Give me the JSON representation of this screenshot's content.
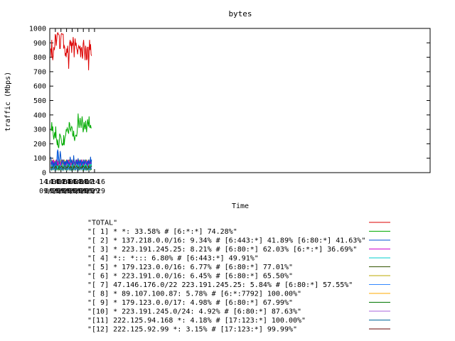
{
  "chart_data": {
    "type": "line",
    "title": "bytes",
    "xlabel": "Time",
    "ylabel": "traffic (Mbps)",
    "ylim": [
      0,
      1000
    ],
    "yticks": [
      0,
      100,
      200,
      300,
      400,
      500,
      600,
      700,
      800,
      900,
      1000
    ],
    "xlim_minutes": [
      840,
      976
    ],
    "xticks": [
      {
        "minute": 840,
        "time": "14:00",
        "date": "09/29"
      },
      {
        "minute": 842,
        "time": "14:02",
        "date": "09/29"
      },
      {
        "minute": 844,
        "time": "14:04",
        "date": "09/29"
      },
      {
        "minute": 846,
        "time": "14:06",
        "date": "09/29"
      },
      {
        "minute": 848,
        "time": "14:08",
        "date": "09/29"
      },
      {
        "minute": 850,
        "time": "14:10",
        "date": "09/29"
      },
      {
        "minute": 852,
        "time": "14:12",
        "date": "09/29"
      },
      {
        "minute": 854,
        "time": "14:14",
        "date": "09/29"
      },
      {
        "minute": 856,
        "time": "14:16",
        "date": "09/29"
      }
    ],
    "grid": false,
    "legend_position": "bottom",
    "series": [
      {
        "name": "\"TOTAL\"",
        "color": "#dd0000",
        "values": [
          860,
          800,
          920,
          820,
          780,
          810,
          870,
          850,
          870,
          960,
          950,
          880,
          920,
          960,
          970,
          960,
          960,
          950,
          860,
          860,
          920,
          960,
          965,
          960,
          960,
          960,
          860,
          880,
          870,
          810,
          830,
          800,
          860,
          830,
          880,
          820,
          720,
          830,
          900,
          920,
          880,
          910,
          830,
          900,
          880,
          940,
          900,
          800,
          880,
          930,
          880,
          900,
          860,
          850,
          820,
          860,
          880,
          870,
          860,
          880,
          800,
          860,
          870,
          810,
          790,
          890,
          920,
          870,
          830,
          780,
          880,
          860,
          780,
          790,
          870,
          870,
          710,
          830,
          920,
          850,
          890,
          820,
          810
        ]
      },
      {
        "name": "\"[ 1] * *: 33.58% # [6:*:*] 74.28%\"",
        "color": "#00aa00",
        "values": [
          290,
          290,
          350,
          290,
          320,
          260,
          230,
          260,
          280,
          240,
          320,
          240,
          220,
          190,
          230,
          180,
          170,
          210,
          270,
          260,
          250,
          230,
          200,
          190,
          200,
          190,
          260,
          190,
          230,
          250,
          260,
          300,
          290,
          310,
          300,
          280,
          270,
          350,
          340,
          300,
          290,
          310,
          320,
          310,
          260,
          250,
          290,
          240,
          220,
          250,
          260,
          260,
          250,
          280,
          330,
          410,
          350,
          310,
          350,
          380,
          340,
          310,
          350,
          390,
          350,
          280,
          300,
          350,
          320,
          300,
          360,
          320,
          280,
          330,
          370,
          340,
          320,
          390,
          320,
          310,
          330,
          310,
          310
        ]
      },
      {
        "name": "\"[ 2] * 137.218.0.0/16: 9.34% # [6:443:*] 41.89% [6:80:*] 41.63%\"",
        "color": "#0050d0",
        "values": [
          110,
          70,
          60,
          80,
          60,
          40,
          70,
          50,
          60,
          80,
          60,
          50,
          70,
          120,
          160,
          140,
          100,
          60,
          90,
          150,
          120,
          80,
          60,
          70,
          80,
          90,
          60,
          70,
          50,
          80,
          60,
          70,
          90,
          60,
          80,
          70,
          60,
          50,
          70,
          110,
          80,
          70,
          90,
          70,
          60,
          50,
          120,
          80,
          70,
          60,
          80,
          90,
          60,
          70,
          50,
          100,
          70,
          60,
          80,
          70,
          90,
          60,
          50,
          80,
          70,
          60,
          90,
          70,
          60,
          80,
          90,
          70,
          60,
          50,
          80,
          70,
          90,
          60,
          70,
          80,
          110,
          60,
          90
        ]
      },
      {
        "name": "\"[ 3] * 223.191.245.25: 8.21% # [6:80:*] 62.03% [6:*:*] 36.69%\"",
        "color": "#cc00cc",
        "values": [
          60,
          80,
          50,
          70,
          90,
          60,
          80,
          70,
          50,
          60,
          80,
          90,
          70,
          60,
          80,
          50,
          60,
          70,
          80,
          60,
          50,
          70,
          60,
          80,
          90,
          70,
          60,
          50,
          80,
          70,
          60,
          50,
          70,
          80,
          60,
          90,
          70,
          60,
          80,
          70,
          50,
          60,
          80,
          70,
          60,
          90,
          80,
          70,
          60,
          50,
          70,
          80,
          60,
          90,
          70,
          60,
          80,
          70,
          60,
          50,
          70,
          60,
          80,
          90,
          70,
          60,
          50,
          80,
          70,
          60,
          90,
          70,
          60,
          80,
          70,
          50,
          60,
          80,
          70,
          60,
          90,
          70,
          60
        ]
      },
      {
        "name": "\"[ 4] *:: *::: 6.80% # [6:443:*] 49.91%\"",
        "color": "#00cccc",
        "values": [
          50,
          60,
          40,
          50,
          70,
          60,
          50,
          40,
          60,
          50,
          70,
          60,
          50,
          40,
          30,
          50,
          60,
          70,
          50,
          40,
          60,
          50,
          70,
          60,
          50,
          40,
          60,
          50,
          70,
          60,
          50,
          60,
          40,
          50,
          70,
          60,
          50,
          40,
          60,
          50,
          70,
          60,
          50,
          40,
          60,
          50,
          70,
          60,
          50,
          60,
          40,
          50,
          70,
          60,
          50,
          40,
          60,
          50,
          70,
          60,
          50,
          40,
          60,
          50,
          70,
          60,
          50,
          60,
          40,
          50,
          70,
          60,
          50,
          40,
          60,
          50,
          70,
          60,
          50,
          40,
          60,
          50,
          60
        ]
      },
      {
        "name": "\"[ 5] * 179.123.0.0/16: 6.77% # [6:80:*] 77.01%\"",
        "color": "#335500",
        "values": [
          40,
          30,
          50,
          40,
          30,
          60,
          40,
          50,
          30,
          40,
          50,
          30,
          40,
          60,
          50,
          40,
          30,
          50,
          40,
          30,
          60,
          40,
          50,
          30,
          40,
          50,
          30,
          40,
          60,
          50,
          40,
          30,
          50,
          40,
          30,
          60,
          40,
          50,
          30,
          40,
          50,
          30,
          40,
          60,
          50,
          40,
          30,
          50,
          40,
          30,
          60,
          40,
          50,
          30,
          40,
          50,
          30,
          40,
          60,
          50,
          40,
          30,
          50,
          40,
          30,
          60,
          40,
          50,
          30,
          40,
          50,
          30,
          40,
          60,
          50,
          40,
          30,
          50,
          40,
          30,
          60,
          40,
          50
        ]
      },
      {
        "name": "\"[ 6] * 223.191.0.0/16: 6.45% # [6:80:*] 65.50%\"",
        "color": "#bbaa00",
        "values": [
          80,
          90,
          70,
          80,
          60,
          70,
          90,
          80,
          70,
          60,
          80,
          70,
          90,
          80,
          60,
          70,
          80,
          90,
          70,
          60,
          80,
          70,
          90,
          80,
          60,
          70,
          80,
          90,
          70,
          60,
          80,
          70,
          90,
          80,
          60,
          70,
          80,
          90,
          70,
          60,
          80,
          70,
          90,
          80,
          60,
          70,
          80,
          90,
          70,
          60,
          80,
          70,
          90,
          80,
          60,
          70,
          80,
          90,
          70,
          60,
          80,
          70,
          90,
          80,
          60,
          70,
          80,
          90,
          70,
          60,
          80,
          70,
          90,
          80,
          60,
          70,
          80,
          90,
          70,
          60,
          80,
          70,
          80
        ]
      },
      {
        "name": "\"[ 7] 47.146.176.0/22 223.191.245.25: 5.84% # [6:80:*] 57.55%\"",
        "color": "#3388ff",
        "values": [
          30,
          20,
          40,
          30,
          20,
          50,
          30,
          40,
          20,
          30,
          40,
          20,
          30,
          150,
          120,
          60,
          30,
          40,
          30,
          20,
          50,
          30,
          40,
          20,
          30,
          40,
          20,
          30,
          50,
          40,
          30,
          20,
          40,
          30,
          20,
          50,
          30,
          40,
          20,
          30,
          40,
          20,
          30,
          50,
          40,
          30,
          20,
          40,
          30,
          20,
          50,
          30,
          40,
          20,
          30,
          40,
          20,
          30,
          50,
          40,
          30,
          20,
          40,
          30,
          20,
          50,
          30,
          40,
          20,
          30,
          40,
          20,
          30,
          50,
          40,
          30,
          20,
          40,
          30,
          20,
          50,
          30,
          40
        ]
      },
      {
        "name": "\"[ 8] * 89.107.100.87: 5.78% # [6:*:7792] 100.00%\"",
        "color": "#ffaa00",
        "values": [
          60,
          50,
          70,
          60,
          50,
          40,
          60,
          50,
          70,
          60,
          50,
          40,
          60,
          50,
          70,
          60,
          50,
          40,
          60,
          50,
          70,
          60,
          50,
          40,
          60,
          50,
          70,
          60,
          50,
          40,
          60,
          50,
          70,
          60,
          50,
          40,
          60,
          50,
          70,
          60,
          50,
          40,
          60,
          50,
          70,
          60,
          50,
          40,
          60,
          50,
          70,
          60,
          50,
          40,
          60,
          50,
          70,
          60,
          50,
          40,
          60,
          50,
          70,
          60,
          50,
          40,
          60,
          50,
          70,
          60,
          50,
          40,
          60,
          50,
          70,
          60,
          50,
          40,
          60,
          50,
          70,
          60,
          50
        ]
      },
      {
        "name": "\"[ 9] * 179.123.0.0/17: 4.98% # [6:80:*] 67.99%\"",
        "color": "#007700",
        "values": [
          20,
          30,
          20,
          40,
          30,
          20,
          30,
          40,
          20,
          30,
          20,
          40,
          30,
          20,
          30,
          40,
          20,
          30,
          20,
          40,
          30,
          20,
          30,
          40,
          20,
          30,
          20,
          40,
          30,
          20,
          30,
          40,
          20,
          30,
          20,
          40,
          30,
          20,
          30,
          40,
          20,
          30,
          20,
          40,
          30,
          20,
          30,
          40,
          20,
          30,
          20,
          40,
          30,
          20,
          30,
          40,
          20,
          30,
          20,
          40,
          30,
          20,
          30,
          40,
          20,
          30,
          20,
          40,
          30,
          20,
          30,
          40,
          20,
          30,
          20,
          40,
          30,
          20,
          30,
          40,
          20,
          30,
          20
        ]
      },
      {
        "name": "\"[10] * 223.191.245.0/24: 4.92% # [6:80:*] 87.63%\"",
        "color": "#aa66dd",
        "values": [
          50,
          40,
          60,
          50,
          40,
          30,
          50,
          40,
          60,
          50,
          40,
          30,
          50,
          40,
          60,
          50,
          40,
          30,
          50,
          40,
          60,
          50,
          40,
          30,
          50,
          40,
          60,
          50,
          40,
          30,
          50,
          40,
          60,
          50,
          40,
          30,
          50,
          40,
          60,
          50,
          40,
          30,
          50,
          40,
          60,
          50,
          40,
          30,
          50,
          40,
          60,
          50,
          40,
          30,
          50,
          40,
          60,
          50,
          40,
          30,
          50,
          40,
          60,
          50,
          40,
          30,
          50,
          40,
          60,
          50,
          40,
          30,
          50,
          40,
          60,
          50,
          40,
          30,
          50,
          40,
          60,
          50,
          40
        ]
      },
      {
        "name": "\"[11] 222.125.94.168 *: 4.18% # [17:123:*] 100.00%\"",
        "color": "#006699",
        "values": [
          40,
          50,
          40,
          30,
          40,
          50,
          40,
          30,
          40,
          50,
          40,
          30,
          40,
          50,
          40,
          30,
          40,
          50,
          40,
          30,
          40,
          50,
          40,
          30,
          40,
          50,
          40,
          30,
          40,
          50,
          40,
          30,
          40,
          50,
          40,
          30,
          40,
          50,
          40,
          30,
          40,
          50,
          40,
          30,
          40,
          50,
          40,
          30,
          40,
          50,
          40,
          30,
          40,
          50,
          40,
          30,
          40,
          50,
          40,
          30,
          40,
          50,
          40,
          30,
          40,
          50,
          40,
          30,
          40,
          50,
          40,
          30,
          40,
          50,
          40,
          30,
          40,
          50,
          40,
          30,
          40,
          50,
          40
        ]
      },
      {
        "name": "\"[12] 222.125.92.99 *: 3.15% # [17:123:*] 99.99%\"",
        "color": "#660000",
        "values": [
          30,
          30,
          30,
          30,
          30,
          30,
          30,
          30,
          30,
          30,
          30,
          30,
          30,
          30,
          30,
          30,
          30,
          30,
          30,
          30,
          30,
          30,
          30,
          30,
          30,
          30,
          30,
          30,
          30,
          30,
          30,
          30,
          30,
          30,
          30,
          30,
          30,
          30,
          30,
          30,
          30,
          30,
          30,
          30,
          30,
          30,
          30,
          30,
          30,
          30,
          30,
          30,
          30,
          30,
          30,
          30,
          30,
          30,
          30,
          30,
          30,
          30,
          30,
          30,
          30,
          30,
          30,
          30,
          30,
          30,
          30,
          30,
          30,
          30,
          30,
          30,
          30,
          30,
          30,
          30,
          30,
          30,
          30
        ]
      }
    ]
  }
}
